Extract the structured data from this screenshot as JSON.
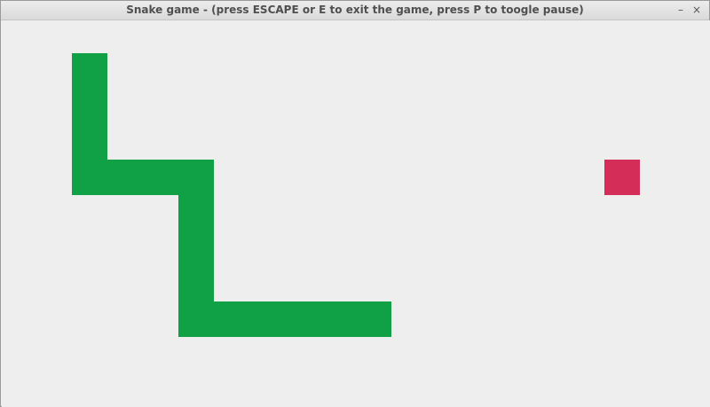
{
  "window": {
    "title": "Snake game - (press ESCAPE or E to exit the game, press P to toogle pause)",
    "minimize_icon": "minimize-icon",
    "close_icon": "close-icon",
    "minimize_glyph": "–",
    "close_glyph": "×"
  },
  "game": {
    "cell_size": 40,
    "snake_color": "#10a045",
    "food_color": "#d42e58",
    "background_color": "#eeeeee",
    "snake_cells": [
      [
        2,
        1
      ],
      [
        2,
        2
      ],
      [
        2,
        3
      ],
      [
        2,
        4
      ],
      [
        3,
        4
      ],
      [
        4,
        4
      ],
      [
        5,
        4
      ],
      [
        5,
        5
      ],
      [
        5,
        6
      ],
      [
        5,
        7
      ],
      [
        5,
        8
      ],
      [
        6,
        8
      ],
      [
        7,
        8
      ],
      [
        8,
        8
      ],
      [
        9,
        8
      ],
      [
        10,
        8
      ]
    ],
    "food": [
      17,
      4
    ]
  }
}
